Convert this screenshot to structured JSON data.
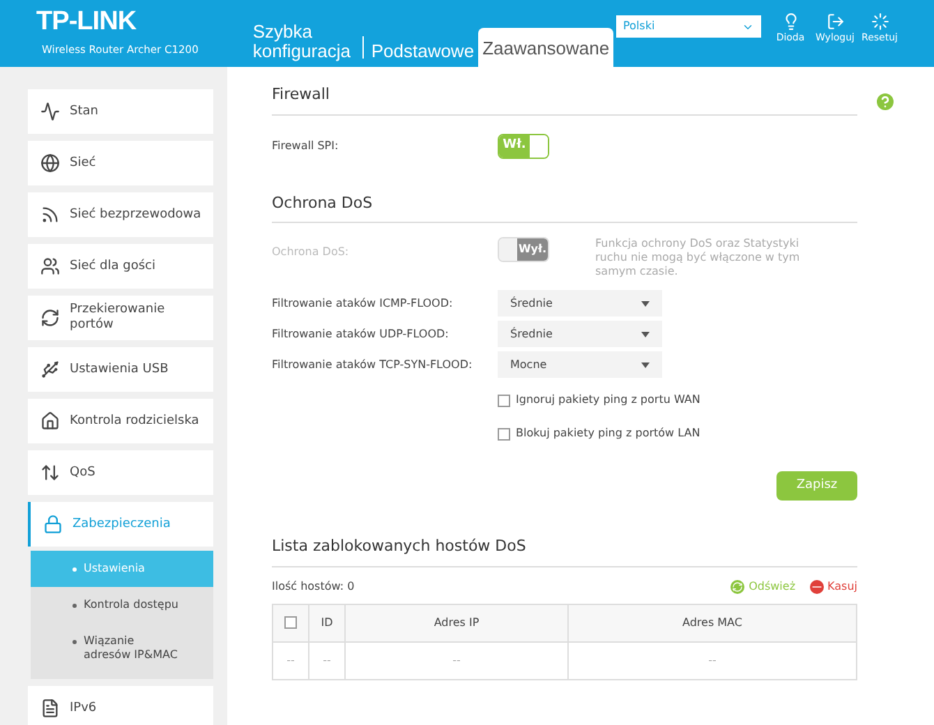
{
  "header": {
    "logo": "TP-LINK",
    "model": "Wireless Router Archer C1200",
    "tabs": [
      {
        "label": "Szybka konfiguracja",
        "selected": false
      },
      {
        "label": "Podstawowe",
        "selected": false
      },
      {
        "label": "Zaawansowane",
        "selected": true
      }
    ],
    "language": "Polski",
    "actions": [
      {
        "kind": "led",
        "label": "Dioda"
      },
      {
        "kind": "logout",
        "label": "Wyloguj"
      },
      {
        "kind": "reset",
        "label": "Resetuj"
      }
    ]
  },
  "sidebar": {
    "items": [
      {
        "kind": "status",
        "label": "Stan",
        "selected": false
      },
      {
        "kind": "network",
        "label": "Sieć",
        "selected": false
      },
      {
        "kind": "wireless",
        "label": "Sieć bezprzewodowa",
        "selected": false
      },
      {
        "kind": "guest",
        "label": "Sieć dla gości",
        "selected": false
      },
      {
        "kind": "forward",
        "label": "Przekierowanie portów",
        "selected": false
      },
      {
        "kind": "usb",
        "label": "Ustawienia USB",
        "selected": false
      },
      {
        "kind": "parental",
        "label": "Kontrola rodzicielska",
        "selected": false
      },
      {
        "kind": "qos",
        "label": "QoS",
        "selected": false
      },
      {
        "kind": "security",
        "label": "Zabezpieczenia",
        "selected": true,
        "children": [
          {
            "label": "Ustawienia",
            "selected": true
          },
          {
            "label": "Kontrola dostępu",
            "selected": false
          },
          {
            "label": "Wiązanie adresów IP&MAC",
            "selected": false
          }
        ]
      },
      {
        "kind": "ipv6",
        "label": "IPv6",
        "selected": false
      }
    ]
  },
  "firewall": {
    "title": "Firewall",
    "spi": {
      "label": "Firewall SPI:",
      "on": true,
      "state_text": "Wł."
    }
  },
  "dos": {
    "title": "Ochrona DoS",
    "protection": {
      "label": "Ochrona DoS:",
      "on": false,
      "disabled": true,
      "state_text": "Wył.",
      "note": "Funkcja ochrony DoS oraz Statystyki ruchu nie mogą być włączone w tym samym czasie."
    },
    "filters": [
      {
        "label": "Filtrowanie ataków ICMP-FLOOD:",
        "value": "Średnie"
      },
      {
        "label": "Filtrowanie ataków UDP-FLOOD:",
        "value": "Średnie"
      },
      {
        "label": "Filtrowanie ataków TCP-SYN-FLOOD:",
        "value": "Mocne"
      }
    ],
    "options": [
      {
        "label": "Ignoruj pakiety ping z portu WAN",
        "checked": false
      },
      {
        "label": "Blokuj pakiety ping z portów LAN",
        "checked": false
      }
    ],
    "save": "Zapisz"
  },
  "blocked": {
    "title": "Lista zablokowanych hostów DoS",
    "count": "Ilość hostów: 0",
    "refresh": "Odśwież",
    "delete": "Kasuj",
    "table": {
      "columns": [
        {
          "kind": "checkbox",
          "checked": false
        },
        {
          "kind": "text",
          "label": "ID"
        },
        {
          "kind": "text",
          "label": "Adres IP"
        },
        {
          "kind": "text",
          "label": "Adres MAC"
        }
      ],
      "rows": [
        [
          "--",
          "--",
          "--",
          "--"
        ]
      ]
    }
  }
}
